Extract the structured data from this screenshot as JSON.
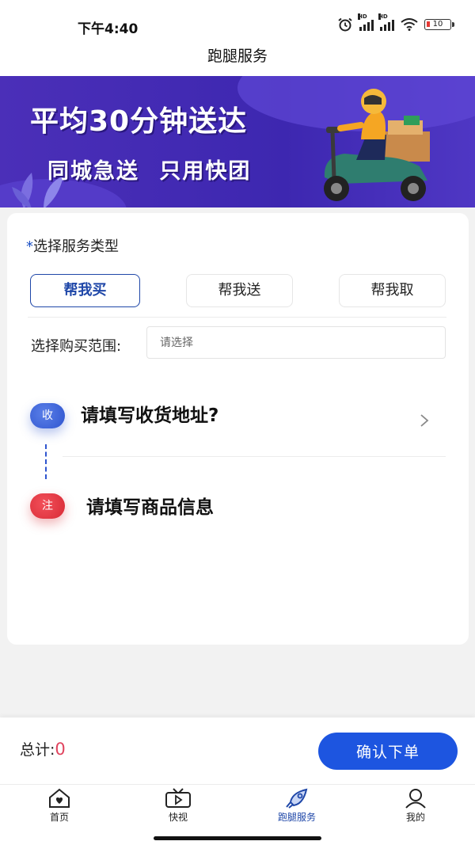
{
  "status_bar": {
    "time": "下午4:40",
    "hd1": "HD",
    "hd2": "HD",
    "battery": "10"
  },
  "nav": {
    "title": "跑腿服务"
  },
  "banner": {
    "line1": "平均30分钟送达",
    "line2": "同城急送  只用快团"
  },
  "service": {
    "required_mark": "*",
    "label": "选择服务类型",
    "tabs": [
      {
        "label": "帮我买",
        "active": true
      },
      {
        "label": "帮我送",
        "active": false
      },
      {
        "label": "帮我取",
        "active": false
      }
    ],
    "range_label": "选择购买范围:",
    "range_placeholder": "请选择"
  },
  "address": {
    "badge": "收",
    "text": "请填写收货地址?"
  },
  "goods": {
    "badge": "注",
    "text": "请填写商品信息"
  },
  "footer": {
    "total_label": "总计:",
    "total_value": "0",
    "confirm": "确认下单"
  },
  "tabbar": {
    "items": [
      {
        "label": "首页",
        "icon": "home-icon"
      },
      {
        "label": "快视",
        "icon": "video-icon"
      },
      {
        "label": "跑腿服务",
        "icon": "rocket-icon",
        "active": true
      },
      {
        "label": "我的",
        "icon": "user-icon"
      }
    ]
  },
  "colors": {
    "primary": "#1d55e0",
    "accent": "#1f47a8",
    "total": "#e0445e",
    "banner": "#4b2fb8"
  }
}
